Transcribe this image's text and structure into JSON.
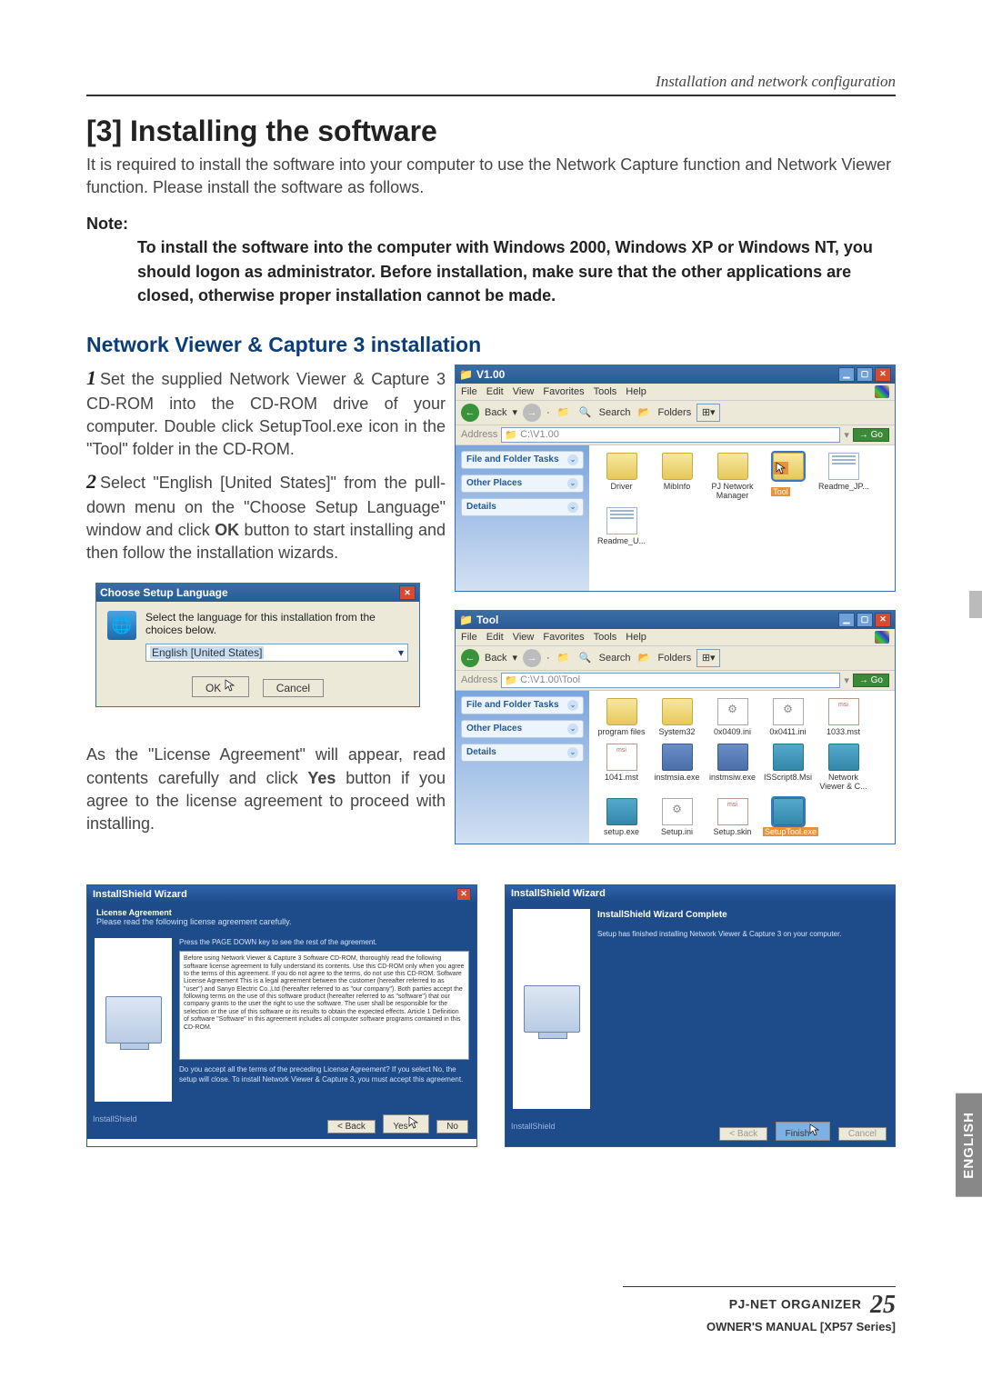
{
  "header": "Installation and network configuration",
  "title": "[3] Installing the software",
  "intro": "It is required to install the software into your computer to use the Network Capture function and Network Viewer function. Please install the software as follows.",
  "note_label": "Note:",
  "note_body": "To install the software into the computer with Windows 2000, Windows XP or Windows NT, you should logon as administrator. Before installation, make sure that the other applications are closed, otherwise proper installation cannot be made.",
  "section_title": "Network Viewer & Capture 3 installation",
  "step1_num": "1",
  "step1": "Set the supplied Network Viewer & Capture 3 CD-ROM into the CD-ROM drive of your computer. Double click SetupTool.exe icon in the \"Tool\" folder in the CD-ROM.",
  "step2_num": "2",
  "step2_a": "Select \"English [United States]\" from the pull-down menu on the \"Choose Setup Language\" window and click ",
  "step2_ok": "OK",
  "step2_b": " button to start installing and then follow the installation wizards.",
  "license_para_a": "As the \"License Agreement\" will appear, read contents carefully and click ",
  "license_yes": "Yes",
  "license_para_b": " button if you agree to the license agreement to proceed with installing.",
  "explorer1": {
    "title": "V1.00",
    "menus": [
      "File",
      "Edit",
      "View",
      "Favorites",
      "Tools",
      "Help"
    ],
    "toolbar": {
      "back": "Back",
      "search": "Search",
      "folders": "Folders"
    },
    "address_label": "Address",
    "address": "C:\\V1.00",
    "go": "Go",
    "side": [
      "File and Folder Tasks",
      "Other Places",
      "Details"
    ],
    "files": [
      {
        "name": "Driver",
        "type": "folder"
      },
      {
        "name": "MibInfo",
        "type": "folder"
      },
      {
        "name": "PJ Network Manager",
        "type": "folder"
      },
      {
        "name": "Tool",
        "type": "folder",
        "selected": true
      },
      {
        "name": "Readme_JP...",
        "type": "doc"
      },
      {
        "name": "Readme_U...",
        "type": "doc"
      }
    ]
  },
  "explorer2": {
    "title": "Tool",
    "menus": [
      "File",
      "Edit",
      "View",
      "Favorites",
      "Tools",
      "Help"
    ],
    "toolbar": {
      "back": "Back",
      "search": "Search",
      "folders": "Folders"
    },
    "address_label": "Address",
    "address": "C:\\V1.00\\Tool",
    "go": "Go",
    "side": [
      "File and Folder Tasks",
      "Other Places",
      "Details"
    ],
    "files": [
      {
        "name": "program files",
        "type": "folder"
      },
      {
        "name": "System32",
        "type": "folder"
      },
      {
        "name": "0x0409.ini",
        "type": "ini"
      },
      {
        "name": "0x0411.ini",
        "type": "ini"
      },
      {
        "name": "1033.mst",
        "type": "msi"
      },
      {
        "name": "1041.mst",
        "type": "msi"
      },
      {
        "name": "instmsia.exe",
        "type": "exe"
      },
      {
        "name": "instmsiw.exe",
        "type": "exe"
      },
      {
        "name": "ISScript8.Msi",
        "type": "setup"
      },
      {
        "name": "Network Viewer & C...",
        "type": "setup"
      },
      {
        "name": "setup.exe",
        "type": "setup"
      },
      {
        "name": "Setup.ini",
        "type": "ini"
      },
      {
        "name": "Setup.skin",
        "type": "msi"
      },
      {
        "name": "SetupTool.exe",
        "type": "setup",
        "selected": true
      }
    ]
  },
  "lang_dialog": {
    "title": "Choose Setup Language",
    "msg": "Select the language for this installation from the choices below.",
    "value": "English [United States]",
    "ok": "OK",
    "cancel": "Cancel"
  },
  "wizard1": {
    "title": "InstallShield Wizard",
    "head": "License Agreement",
    "sub": "Please read the following license agreement carefully.",
    "instruction": "Press the PAGE DOWN key to see the rest of the agreement.",
    "text": "Before using Network Viewer & Capture 3 Software CD-ROM, thoroughly read the following software license agreement to fully understand its contents.\nUse this CD-ROM only when you agree to the terms of this agreement.\nIf you do not agree to the terms, do not use this CD-ROM.\n\nSoftware License Agreement\n\nThis is a legal agreement between the customer (hereafter referred to as \"user\") and Sanyo Electric Co.,Ltd (hereafter referred to as \"our company\"). Both parties accept the following terms on the use of this software product (hereafter referred to as \"software\") that our company grants to the user the right to use the software.\nThe user shall be responsible for the selection or the use of this software or its results to obtain the expected effects.\n\nArticle 1 Definition of software\n\"Software\" in this agreement includes all computer software programs contained in this CD-ROM.",
    "confirm": "Do you accept all the terms of the preceding License Agreement? If you select No, the setup will close. To install Network Viewer & Capture 3, you must accept this agreement.",
    "brand": "InstallShield",
    "back": "< Back",
    "yes": "Yes",
    "no": "No"
  },
  "wizard2": {
    "title": "InstallShield Wizard",
    "head": "InstallShield Wizard Complete",
    "msg": "Setup has finished installing Network Viewer & Capture 3 on your computer.",
    "brand": "InstallShield",
    "back": "< Back",
    "finish": "Finish",
    "cancel": "Cancel"
  },
  "side_tab": "ENGLISH",
  "footer_l1": "PJ-NET ORGANIZER",
  "footer_l2": "OWNER'S MANUAL [XP57 Series]",
  "page_no": "25"
}
